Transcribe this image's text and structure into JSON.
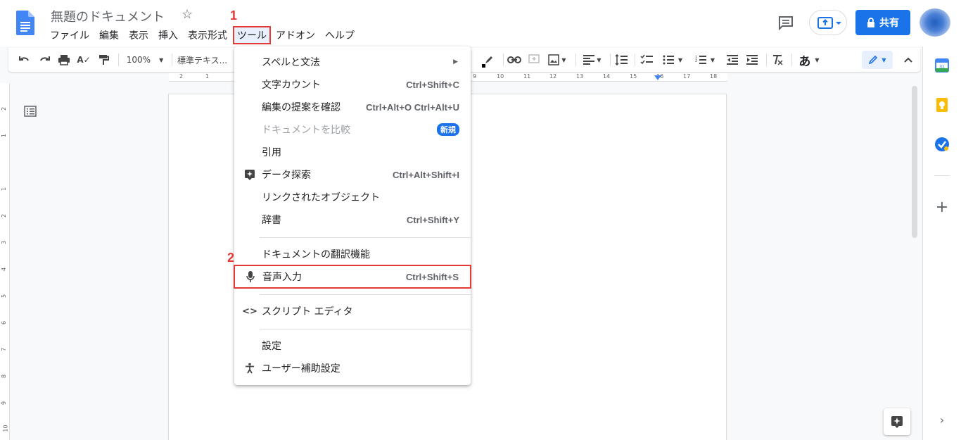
{
  "document": {
    "title": "無題のドキュメント"
  },
  "menubar": {
    "items": [
      "ファイル",
      "編集",
      "表示",
      "挿入",
      "表示形式",
      "ツール",
      "アドオン",
      "ヘルプ"
    ]
  },
  "steps": {
    "step1": "1",
    "step2": "2"
  },
  "header": {
    "share_label": "共有"
  },
  "toolbar": {
    "zoom": "100%",
    "style": "標準テキス...",
    "input_tool": "あ"
  },
  "hruler": {
    "labels": [
      "2",
      "1",
      "9",
      "10",
      "11",
      "12",
      "13",
      "14",
      "15",
      "16",
      "17",
      "18"
    ]
  },
  "vruler": {
    "labels": [
      "2",
      "1",
      "1",
      "2",
      "3",
      "4",
      "5",
      "6",
      "7",
      "8",
      "9",
      "10"
    ]
  },
  "tools_menu": {
    "items": [
      {
        "label": "スペルと文法",
        "shortcut": "",
        "submenu": true
      },
      {
        "label": "文字カウント",
        "shortcut": "Ctrl+Shift+C"
      },
      {
        "label": "編集の提案を確認",
        "shortcut": "Ctrl+Alt+O Ctrl+Alt+U"
      },
      {
        "label": "ドキュメントを比較",
        "badge": "新規",
        "disabled": true
      },
      {
        "label": "引用",
        "shortcut": ""
      },
      {
        "label": "データ探索",
        "shortcut": "Ctrl+Alt+Shift+I",
        "icon": "explore-icon"
      },
      {
        "label": "リンクされたオブジェクト",
        "shortcut": ""
      },
      {
        "label": "辞書",
        "shortcut": "Ctrl+Shift+Y"
      },
      {
        "label": "ドキュメントの翻訳機能",
        "shortcut": ""
      },
      {
        "label": "音声入力",
        "shortcut": "Ctrl+Shift+S",
        "icon": "microphone-icon"
      },
      {
        "label": "スクリプト エディタ",
        "shortcut": "",
        "icon": "code-icon"
      },
      {
        "label": "設定",
        "shortcut": ""
      },
      {
        "label": "ユーザー補助設定",
        "shortcut": "",
        "icon": "accessibility-icon"
      }
    ]
  },
  "colors": {
    "accent": "#1a73e8",
    "highlight_border": "#e53935"
  }
}
